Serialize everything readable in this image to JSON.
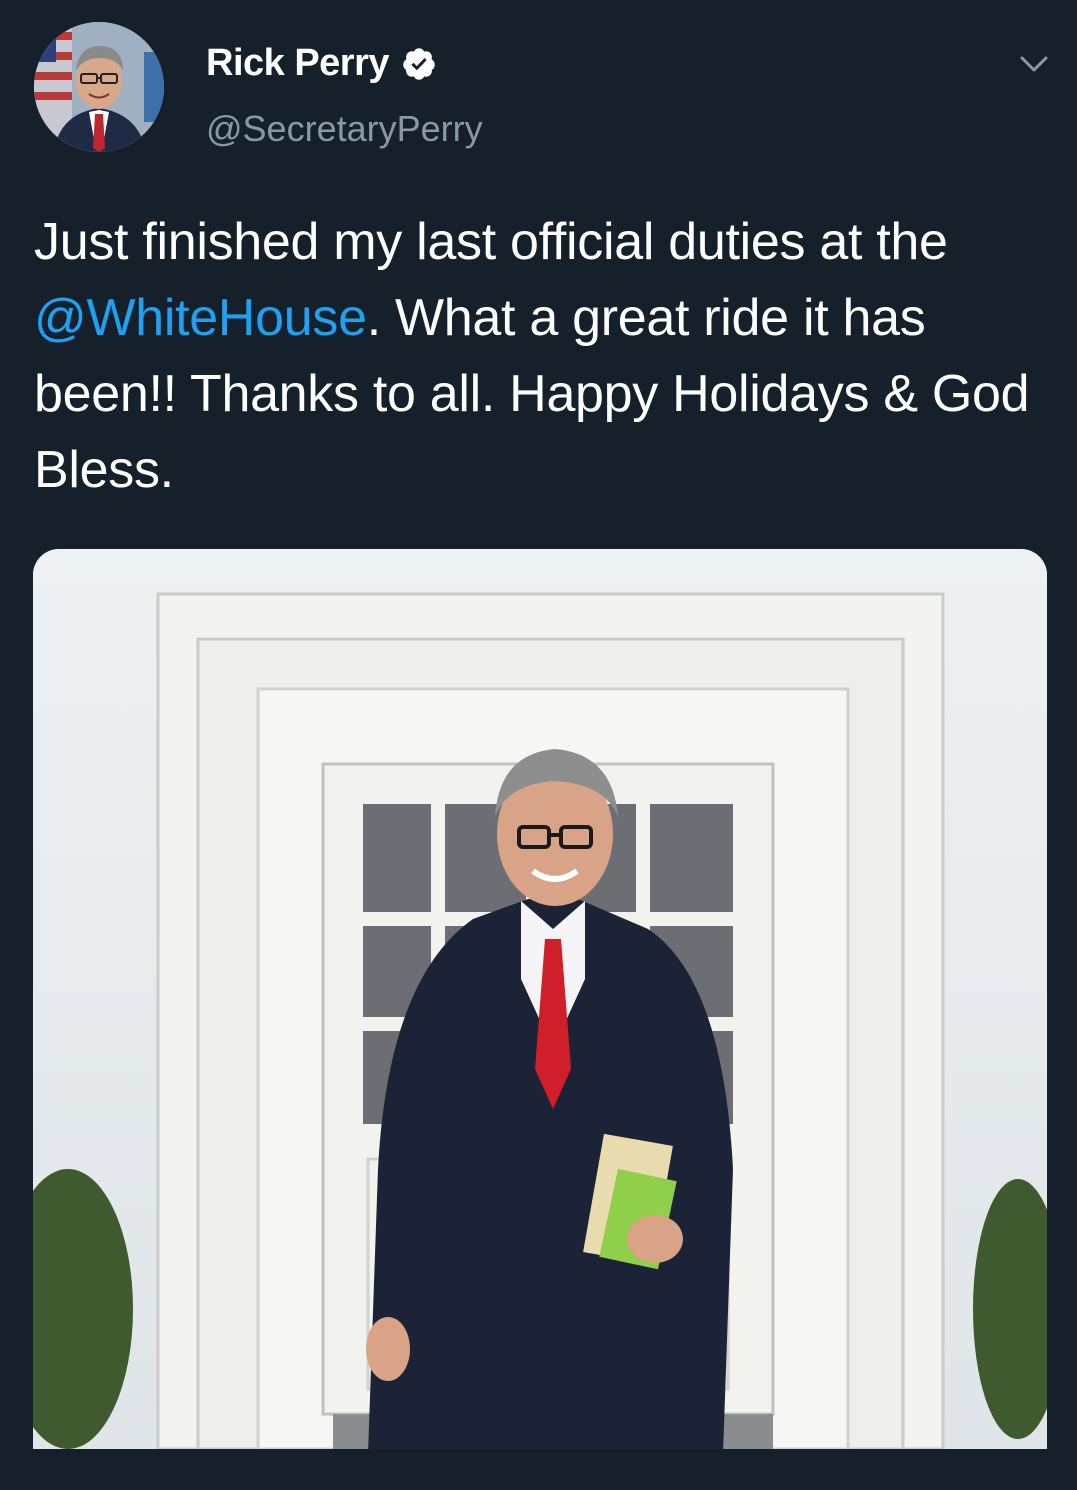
{
  "tweet": {
    "author": {
      "display_name": "Rick Perry",
      "handle": "@SecretaryPerry",
      "verified": true
    },
    "text_before": "Just finished my last official duties at the ",
    "mention": "@WhiteHouse",
    "text_after": ". What a great ride it has been!!  Thanks to all. Happy Holidays & God Bless.",
    "icons": {
      "verified": "verified-badge-icon",
      "menu": "chevron-down-icon"
    }
  },
  "colors": {
    "background": "#15202b",
    "text": "#ffffff",
    "secondary_text": "#8899a6",
    "link": "#1da1f2"
  }
}
